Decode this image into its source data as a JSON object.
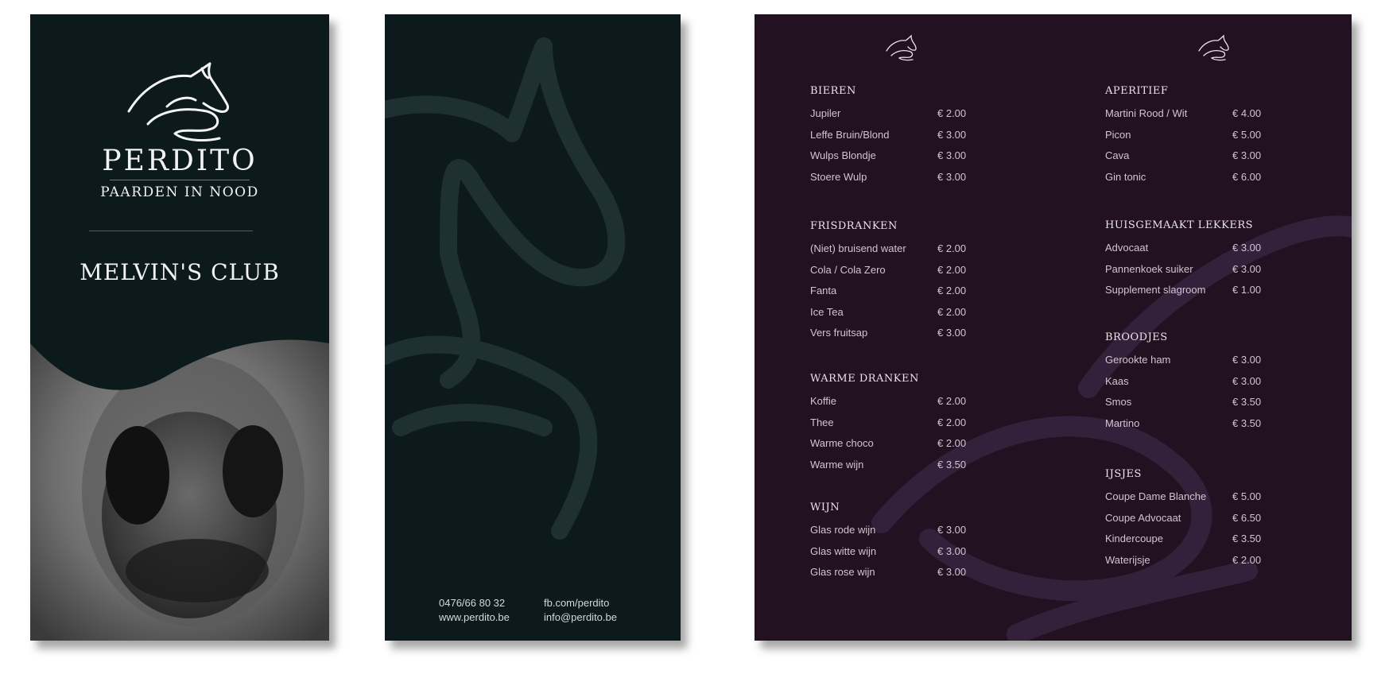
{
  "cover": {
    "brand_name": "PERDITO",
    "brand_subtitle": "PAARDEN IN NOOD",
    "club_name": "MELVIN'S CLUB"
  },
  "back": {
    "contact": {
      "phone": "0476/66 80 32",
      "website": "www.perdito.be",
      "facebook": "fb.com/perdito",
      "email": "info@perdito.be"
    }
  },
  "menu": {
    "left_sections": [
      {
        "title": "BIEREN",
        "items": [
          {
            "name": "Jupiler",
            "price": "€ 2.00"
          },
          {
            "name": "Leffe Bruin/Blond",
            "price": "€ 3.00"
          },
          {
            "name": "Wulps Blondje",
            "price": "€ 3.00"
          },
          {
            "name": "Stoere Wulp",
            "price": "€ 3.00"
          }
        ]
      },
      {
        "title": "FRISDRANKEN",
        "items": [
          {
            "name": "(Niet) bruisend water",
            "price": "€ 2.00"
          },
          {
            "name": "Cola / Cola Zero",
            "price": "€ 2.00"
          },
          {
            "name": "Fanta",
            "price": "€ 2.00"
          },
          {
            "name": "Ice Tea",
            "price": "€ 2.00"
          },
          {
            "name": "Vers fruitsap",
            "price": "€ 3.00"
          }
        ]
      },
      {
        "title": "WARME DRANKEN",
        "items": [
          {
            "name": "Koffie",
            "price": "€ 2.00"
          },
          {
            "name": "Thee",
            "price": "€ 2.00"
          },
          {
            "name": "Warme choco",
            "price": "€ 2.00"
          },
          {
            "name": "Warme wijn",
            "price": "€ 3.50"
          }
        ]
      },
      {
        "title": "WIJN",
        "items": [
          {
            "name": "Glas rode wijn",
            "price": "€ 3.00"
          },
          {
            "name": "Glas witte wijn",
            "price": "€ 3.00"
          },
          {
            "name": "Glas rose wijn",
            "price": "€ 3.00"
          }
        ]
      }
    ],
    "right_sections": [
      {
        "title": "APERITIEF",
        "items": [
          {
            "name": "Martini Rood / Wit",
            "price": "€ 4.00"
          },
          {
            "name": "Picon",
            "price": "€ 5.00"
          },
          {
            "name": "Cava",
            "price": "€ 3.00"
          },
          {
            "name": "Gin tonic",
            "price": "€ 6.00"
          }
        ]
      },
      {
        "title": "HUISGEMAAKT LEKKERS",
        "items": [
          {
            "name": "Advocaat",
            "price": "€ 3.00"
          },
          {
            "name": "Pannenkoek suiker",
            "price": "€ 3.00"
          },
          {
            "name": "Supplement slagroom",
            "price": "€ 1.00"
          }
        ]
      },
      {
        "title": "BROODJES",
        "items": [
          {
            "name": "Gerookte ham",
            "price": "€ 3.00"
          },
          {
            "name": "Kaas",
            "price": "€ 3.00"
          },
          {
            "name": "Smos",
            "price": "€ 3.50"
          },
          {
            "name": "Martino",
            "price": "€ 3.50"
          }
        ]
      },
      {
        "title": "IJSJES",
        "items": [
          {
            "name": "Coupe Dame Blanche",
            "price": "€ 5.00"
          },
          {
            "name": "Coupe Advocaat",
            "price": "€ 6.50"
          },
          {
            "name": "Kindercoupe",
            "price": "€ 3.50"
          },
          {
            "name": "Waterijsje",
            "price": "€ 2.00"
          }
        ]
      }
    ]
  }
}
